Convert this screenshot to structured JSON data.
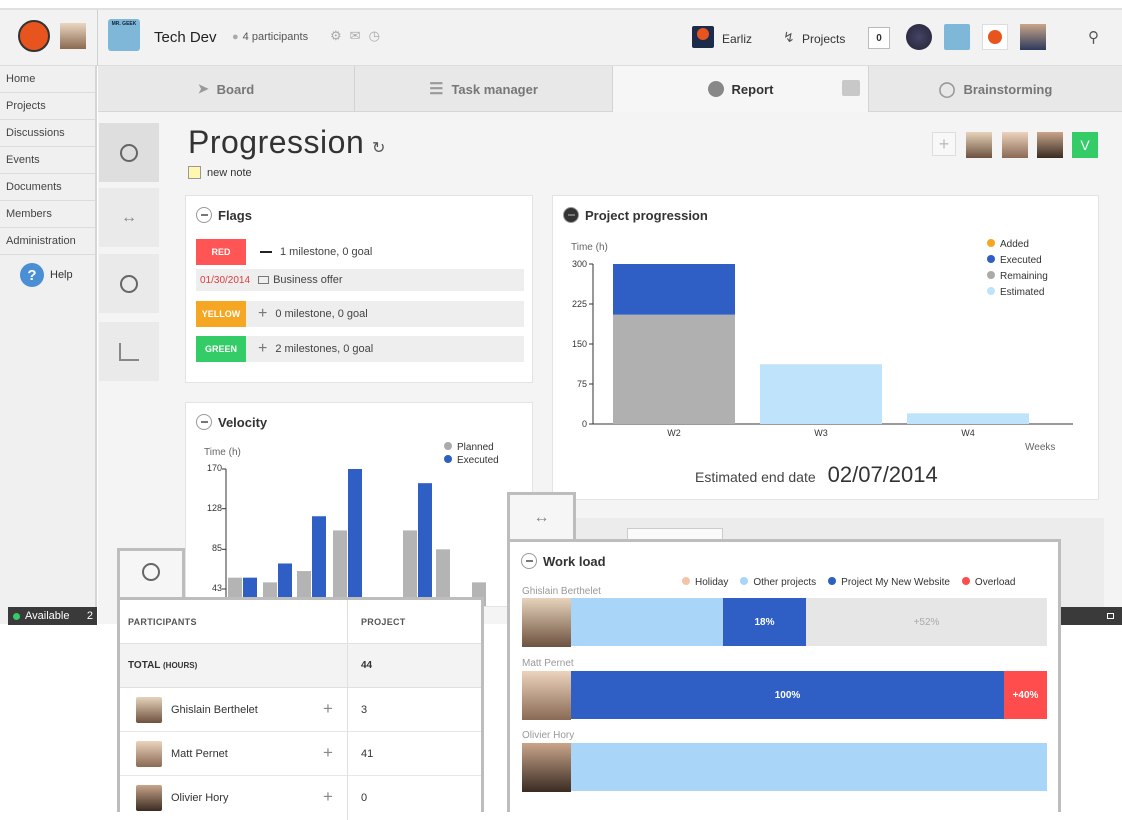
{
  "topbar": {
    "project_title": "Tech Dev",
    "participants": "4 participants",
    "earliz_label": "Earliz",
    "projects_label": "Projects",
    "notif_count": "0",
    "logo_mini_text": "MR. GEEK"
  },
  "nav": [
    {
      "label": "Home"
    },
    {
      "label": "Projects"
    },
    {
      "label": "Discussions"
    },
    {
      "label": "Events"
    },
    {
      "label": "Documents"
    },
    {
      "label": "Members"
    },
    {
      "label": "Administration"
    }
  ],
  "help_label": "Help",
  "tabs": {
    "board": "Board",
    "task_manager": "Task manager",
    "report": "Report",
    "brainstorming": "Brainstorming"
  },
  "page": {
    "title": "Progression",
    "new_note": "new note",
    "validate_label": "V"
  },
  "flags": {
    "title": "Flags",
    "rows": [
      {
        "tag": "RED",
        "color": "#ff5555",
        "text": "1 milestone, 0 goal"
      },
      {
        "date": "01/30/2014",
        "text": "Business offer"
      },
      {
        "tag": "YELLOW",
        "color": "#f5a623",
        "text": "0 milestone, 0 goal"
      },
      {
        "tag": "GREEN",
        "color": "#33cc66",
        "text": "2 milestones, 0 goal"
      }
    ]
  },
  "velocity": {
    "title": "Velocity",
    "ylabel": "Time (h)",
    "ticks": [
      "170",
      "128",
      "85",
      "43"
    ],
    "legend": [
      {
        "name": "Planned",
        "color": "#aaaaaa"
      },
      {
        "name": "Executed",
        "color": "#2f5fc4"
      }
    ]
  },
  "velocity_bars": [
    {
      "planned": 55,
      "executed": 55
    },
    {
      "planned": 50,
      "executed": 70
    },
    {
      "planned": 62,
      "executed": 120
    },
    {
      "planned": 105,
      "executed": 170
    },
    {
      "planned": 105,
      "executed": 155
    },
    {
      "planned": 85,
      "executed": 0
    },
    {
      "planned": 50,
      "executed": 0
    }
  ],
  "progress": {
    "title": "Project progression",
    "estimated_label": "Estimated end date",
    "estimated_date": "02/07/2014"
  },
  "chart_data": {
    "type": "bar",
    "title": "Project progression",
    "ylabel": "Time (h)",
    "xlabel": "Weeks",
    "ylim": [
      0,
      300
    ],
    "ticks": [
      "300",
      "225",
      "150",
      "75",
      "0"
    ],
    "categories": [
      "W2",
      "W3",
      "W4"
    ],
    "series": [
      {
        "name": "Added",
        "color": "#f5a623",
        "values": [
          0,
          0,
          0
        ]
      },
      {
        "name": "Executed",
        "color": "#2f5fc4",
        "values": [
          95,
          0,
          0
        ]
      },
      {
        "name": "Remaining",
        "color": "#b0b0b0",
        "values": [
          205,
          0,
          0
        ]
      },
      {
        "name": "Estimated",
        "color": "#bfe3fb",
        "values": [
          0,
          112,
          20
        ]
      }
    ]
  },
  "status": {
    "label": "Available",
    "count": "2"
  },
  "participants": {
    "col1": "PARTICIPANTS",
    "col2": "PROJECT",
    "total_label": "TOTAL",
    "total_unit": "(HOURS)",
    "total_value": "44",
    "rows": [
      {
        "name": "Ghislain Berthelet",
        "value": "3"
      },
      {
        "name": "Matt Pernet",
        "value": "41"
      },
      {
        "name": "Olivier Hory",
        "value": "0"
      }
    ]
  },
  "workload": {
    "title": "Work load",
    "legend": [
      {
        "name": "Holiday",
        "color": "#f6c3a8"
      },
      {
        "name": "Other projects",
        "color": "#a8d5f8"
      },
      {
        "name": "Project My New Website",
        "color": "#2f5fc4"
      },
      {
        "name": "Overload",
        "color": "#ff4c4c"
      }
    ],
    "people": [
      {
        "name": "Ghislain Berthelet",
        "pct": "18%",
        "extra": "+52%"
      },
      {
        "name": "Matt Pernet",
        "pct": "100%",
        "extra": "+40%"
      },
      {
        "name": "Olivier Hory",
        "pct": "",
        "extra": ""
      }
    ]
  }
}
